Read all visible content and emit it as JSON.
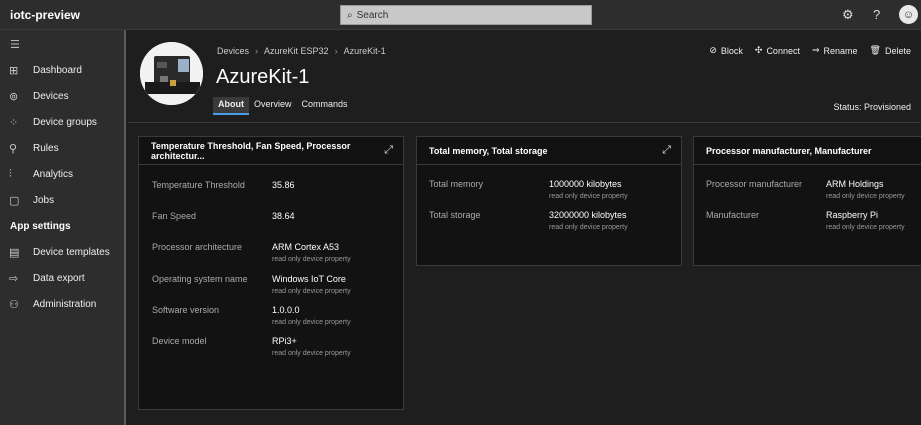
{
  "topbar": {
    "app_title": "iotc-preview",
    "search_placeholder": "Search",
    "settings_icon": "⚙",
    "help_icon": "?",
    "avatar_icon": "☺"
  },
  "sidebar": {
    "items": [
      {
        "icon": "⊞",
        "label": "Dashboard"
      },
      {
        "icon": "⊚",
        "label": "Devices"
      },
      {
        "icon": "⁘",
        "label": "Device groups"
      },
      {
        "icon": "⚲",
        "label": "Rules"
      },
      {
        "icon": "⫶",
        "label": "Analytics"
      },
      {
        "icon": "▢",
        "label": "Jobs"
      }
    ],
    "section": "App settings",
    "settings_items": [
      {
        "icon": "▤",
        "label": "Device templates"
      },
      {
        "icon": "⇨",
        "label": "Data export"
      },
      {
        "icon": "⚇",
        "label": "Administration"
      }
    ]
  },
  "header": {
    "breadcrumb": [
      "Devices",
      "AzureKit ESP32",
      "AzureKit-1"
    ],
    "title": "AzureKit-1",
    "tabs": [
      "About",
      "Overview",
      "Commands"
    ],
    "actions": [
      {
        "icon": "⊘",
        "label": "Block"
      },
      {
        "icon": "✣",
        "label": "Connect"
      },
      {
        "icon": "⇒",
        "label": "Rename"
      },
      {
        "icon": "🗑",
        "label": "Delete"
      }
    ],
    "status": "Status: Provisioned"
  },
  "cards": [
    {
      "title": "Temperature Threshold, Fan Speed, Processor architectur...",
      "props": [
        {
          "name": "Temperature Threshold",
          "value": "35.86",
          "note": ""
        },
        {
          "name": "Fan Speed",
          "value": "38.64",
          "note": ""
        },
        {
          "name": "Processor architecture",
          "value": "ARM Cortex A53",
          "note": "read only device property"
        },
        {
          "name": "Operating system name",
          "value": "Windows IoT Core",
          "note": "read only device property"
        },
        {
          "name": "Software version",
          "value": "1.0.0.0",
          "note": "read only device property"
        },
        {
          "name": "Device model",
          "value": "RPi3+",
          "note": "read only device property"
        }
      ]
    },
    {
      "title": "Total memory, Total storage",
      "props": [
        {
          "name": "Total memory",
          "value": "1000000 kilobytes",
          "note": "read only device property"
        },
        {
          "name": "Total storage",
          "value": "32000000 kilobytes",
          "note": "read only device property"
        }
      ]
    },
    {
      "title": "Processor manufacturer, Manufacturer",
      "props": [
        {
          "name": "Processor manufacturer",
          "value": "ARM Holdings",
          "note": "read only device property"
        },
        {
          "name": "Manufacturer",
          "value": "Raspberry Pi",
          "note": "read only device property"
        }
      ]
    }
  ],
  "expand_icon": "⤢"
}
